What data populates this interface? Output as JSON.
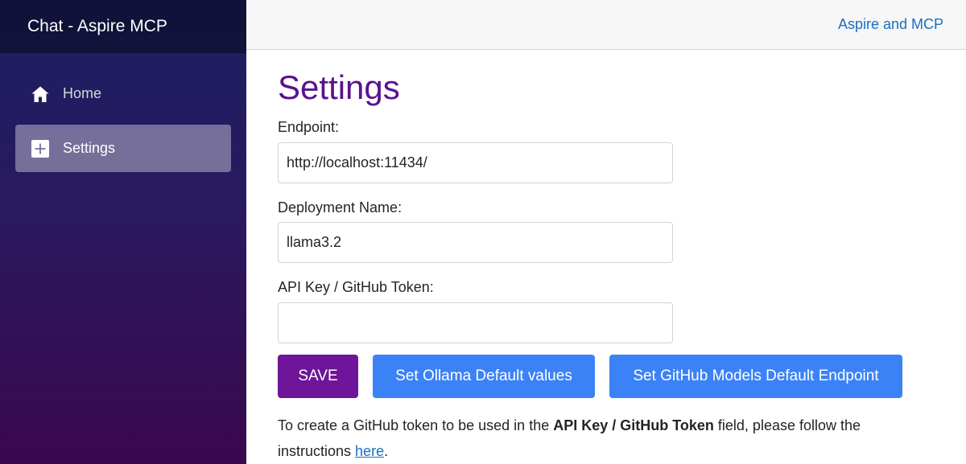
{
  "sidebar": {
    "brand": "Chat - Aspire MCP",
    "items": [
      {
        "label": "Home",
        "icon": "home-icon",
        "active": false
      },
      {
        "label": "Settings",
        "icon": "plus-square-icon",
        "active": true
      }
    ]
  },
  "header": {
    "link": "Aspire and MCP"
  },
  "page": {
    "title": "Settings",
    "fields": {
      "endpoint": {
        "label": "Endpoint:",
        "value": "http://localhost:11434/"
      },
      "deployment": {
        "label": "Deployment Name:",
        "value": "llama3.2"
      },
      "api_key": {
        "label": "API Key / GitHub Token:",
        "value": ""
      }
    },
    "buttons": {
      "save": "SAVE",
      "ollama": "Set Ollama Default values",
      "github": "Set GitHub Models Default Endpoint"
    },
    "note": {
      "part1": "To create a GitHub token to be used in the ",
      "bold": "API Key / GitHub Token",
      "part2": " field, please follow the instructions ",
      "link": "here",
      "part3": "."
    }
  },
  "colors": {
    "title": "#5a1190",
    "save_button": "#6e1599",
    "blue_button": "#3b82f6",
    "link": "#1b6ec2"
  }
}
